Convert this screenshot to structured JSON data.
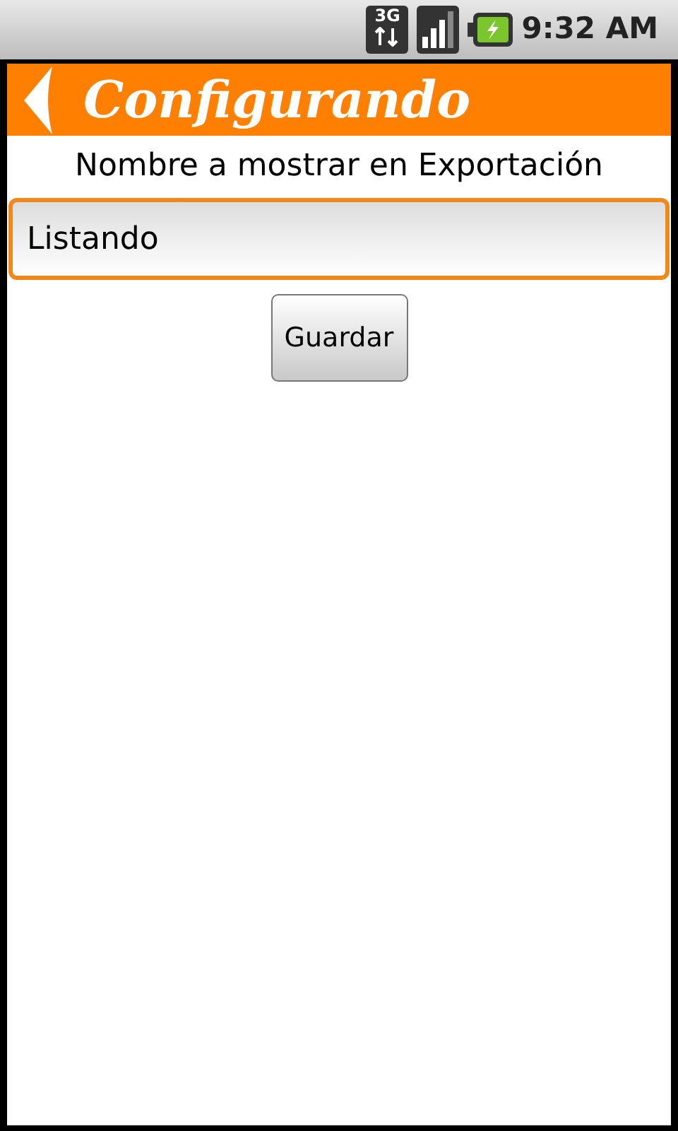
{
  "status_bar": {
    "network": "3G",
    "time": "9:32 AM"
  },
  "header": {
    "title": "Configurando"
  },
  "form": {
    "label": "Nombre a mostrar en Exportación",
    "field": {
      "value": "Listando",
      "focused": true
    },
    "button": "Guardar"
  }
}
